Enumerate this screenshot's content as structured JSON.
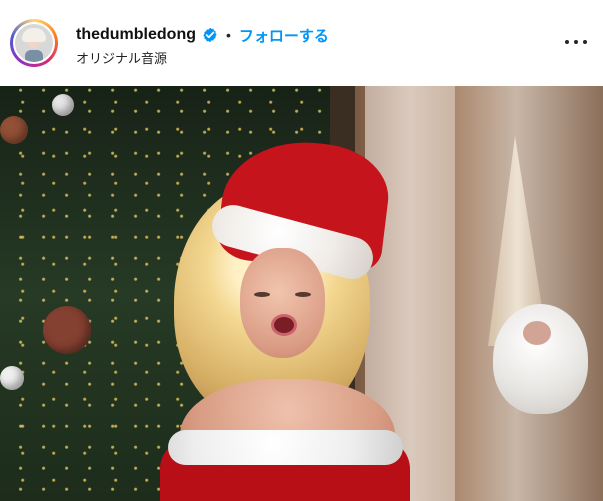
{
  "post": {
    "username": "thedumbledong",
    "separator": "•",
    "follow_label": "フォローする",
    "audio_label": "オリジナル音源"
  },
  "icons": {
    "verified": "verified-badge-icon",
    "more": "more-options-icon",
    "avatar": "profile-avatar"
  },
  "colors": {
    "follow": "#0095f6",
    "verified": "#0095f6",
    "text": "#111111",
    "hat": "#c5141b"
  }
}
